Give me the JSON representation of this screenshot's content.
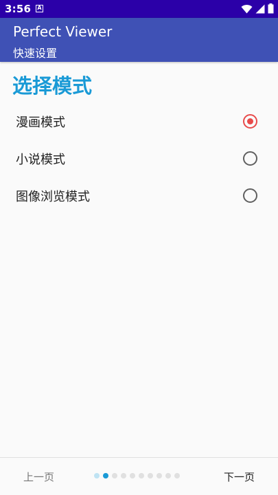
{
  "status_bar": {
    "time": "3:56",
    "notification_icon": "a-box-icon",
    "icons": [
      "wifi-icon",
      "signal-icon",
      "battery-icon"
    ]
  },
  "app_bar": {
    "title": "Perfect Viewer",
    "subtitle": "快速设置"
  },
  "section": {
    "title": "选择模式"
  },
  "options": [
    {
      "label": "漫画模式",
      "checked": true
    },
    {
      "label": "小说模式",
      "checked": false
    },
    {
      "label": "图像浏览模式",
      "checked": false
    }
  ],
  "bottom_bar": {
    "prev_label": "上一页",
    "next_label": "下一页",
    "page_count": 10,
    "current_page": 2
  },
  "colors": {
    "status_bar": "#2b00a8",
    "app_bar": "#3f51b5",
    "accent": "#1a9ad6",
    "radio_checked": "#e84a4a"
  }
}
